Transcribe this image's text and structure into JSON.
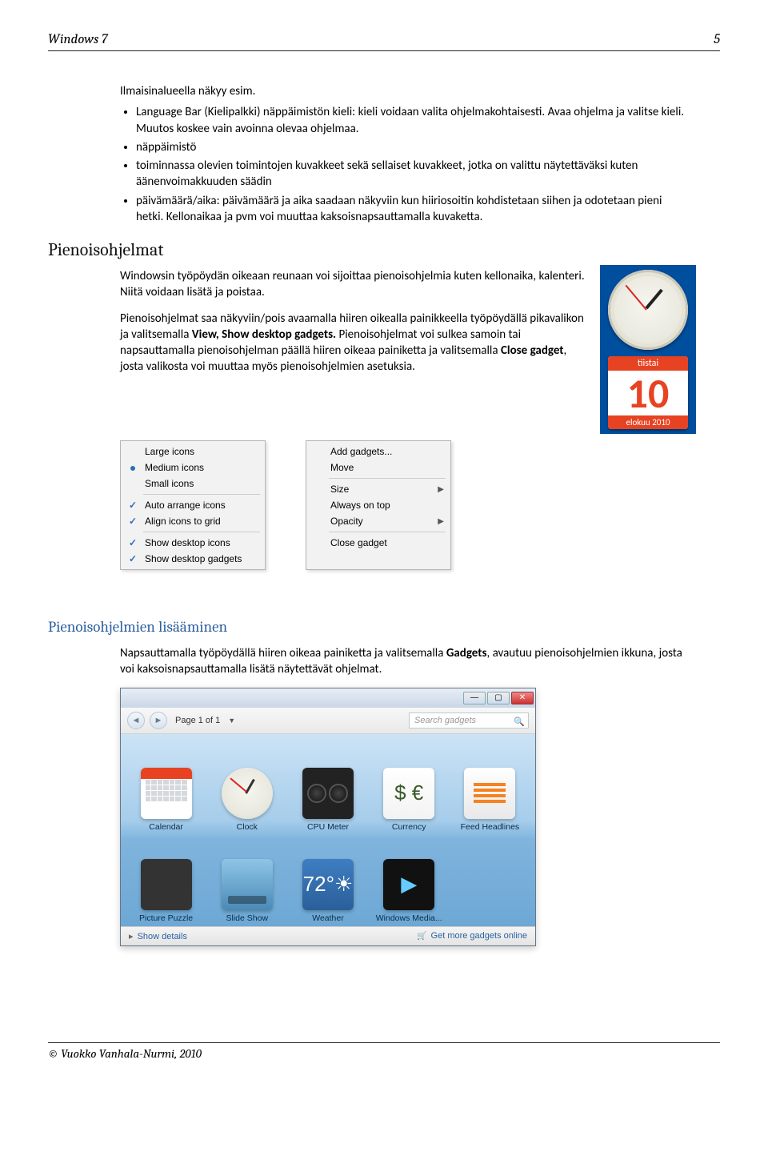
{
  "header": {
    "left": "Windows 7",
    "right": "5"
  },
  "intro": {
    "lead": "Ilmaisinalueella näkyy esim.",
    "items": [
      "Language Bar (Kielipalkki) näppäimistön kieli: kieli voidaan valita ohjelmakohtaisesti. Avaa ohjelma ja valitse kieli. Muutos koskee vain avoinna olevaa ohjelmaa.",
      "näppäimistö",
      "toiminnassa olevien toimintojen kuvakkeet sekä sellaiset kuvakkeet, jotka on valittu näytettäväksi kuten äänenvoimakkuuden säädin",
      "päivämäärä/aika: päivämäärä ja aika saadaan näkyviin kun hiiriosoitin kohdistetaan siihen ja odotetaan pieni hetki. Kellonaikaa ja pvm voi muuttaa kaksoisnapsauttamalla kuvaketta."
    ]
  },
  "section1": {
    "title": "Pienoisohjelmat",
    "p1": "Windowsin työpöydän oikeaan reunaan voi sijoittaa pienoisohjelmia kuten kellonaika, kalenteri. Niitä voidaan lisätä ja poistaa.",
    "p2a": "Pienoisohjelmat saa näkyviin/pois avaamalla hiiren oikealla painikkeella työpöydällä pikavalikon ja valitsemalla ",
    "p2b": "View, Show desktop gadgets.",
    "p2c": " Pienoisohjelmat voi sulkea samoin  tai napsauttamalla pienoisohjelman päällä hiiren oikeaa painiketta ja valitsemalla ",
    "p2d": "Close gadget",
    "p2e": ", josta valikosta voi muuttaa myös pienoisohjelmien asetuksia."
  },
  "calendar": {
    "weekday": "tiistai",
    "day": "10",
    "month": "elokuu 2010"
  },
  "menu1": {
    "items": [
      {
        "label": "Large icons",
        "type": "radio",
        "checked": false
      },
      {
        "label": "Medium icons",
        "type": "radio",
        "checked": true
      },
      {
        "label": "Small icons",
        "type": "radio",
        "checked": false
      },
      {
        "label": "sep"
      },
      {
        "label": "Auto arrange icons",
        "type": "check",
        "checked": true
      },
      {
        "label": "Align icons to grid",
        "type": "check",
        "checked": true
      },
      {
        "label": "sep"
      },
      {
        "label": "Show desktop icons",
        "type": "check",
        "checked": true
      },
      {
        "label": "Show desktop gadgets",
        "type": "check",
        "checked": true
      }
    ]
  },
  "menu2": {
    "items": [
      {
        "label": "Add gadgets..."
      },
      {
        "label": "Move"
      },
      {
        "label": "sep"
      },
      {
        "label": "Size",
        "arrow": true
      },
      {
        "label": "Always on top"
      },
      {
        "label": "Opacity",
        "arrow": true
      },
      {
        "label": "sep"
      },
      {
        "label": "Close gadget"
      }
    ]
  },
  "section2": {
    "title": "Pienoisohjelmien lisääminen",
    "p1a": "Napsauttamalla  työpöydällä hiiren oikeaa painiketta ja valitsemalla ",
    "p1b": "Gadgets",
    "p1c": ", avautuu pienoisohjelmien ikkuna, josta voi kaksoisnapsauttamalla lisätä näytettävät ohjelmat."
  },
  "gadget_window": {
    "page_label": "Page 1 of 1",
    "search_placeholder": "Search gadgets",
    "gadgets": [
      "Calendar",
      "Clock",
      "CPU Meter",
      "Currency",
      "Feed Headlines",
      "Picture Puzzle",
      "Slide Show",
      "Weather",
      "Windows Media..."
    ],
    "footer_left": "Show details",
    "footer_right": "Get more gadgets online"
  },
  "footer": {
    "text": "© Vuokko Vanhala-Nurmi, 2010"
  }
}
